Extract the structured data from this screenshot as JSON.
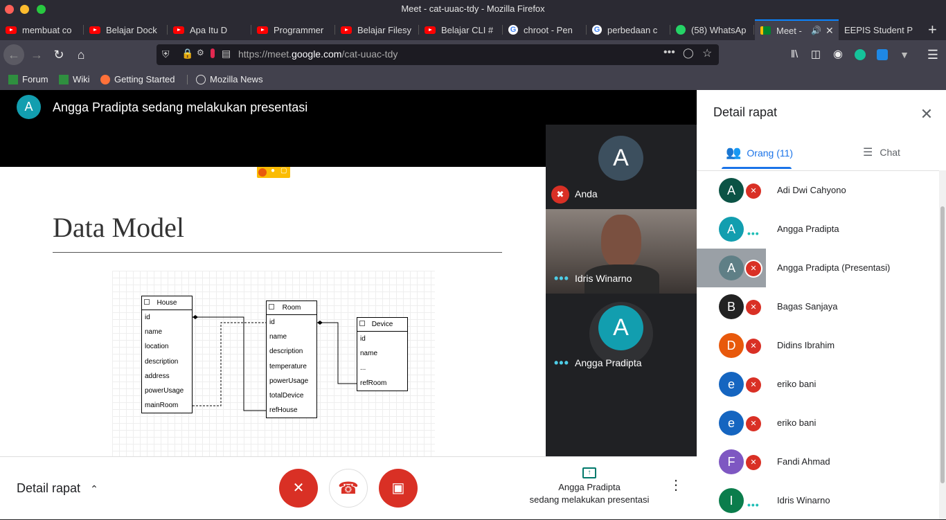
{
  "browser": {
    "window_title": "Meet - cat-uuac-tdy - Mozilla Firefox",
    "tabs": [
      {
        "label": "membuat co",
        "icon": "youtube-icon"
      },
      {
        "label": "Belajar Dock",
        "icon": "youtube-icon"
      },
      {
        "label": "Apa Itu D",
        "icon": "youtube-icon"
      },
      {
        "label": "Programmer",
        "icon": "youtube-icon"
      },
      {
        "label": "Belajar Filesy",
        "icon": "youtube-icon"
      },
      {
        "label": "Belajar CLI #",
        "icon": "youtube-icon"
      },
      {
        "label": "chroot - Pen",
        "icon": "google-icon"
      },
      {
        "label": "perbedaan c",
        "icon": "google-icon"
      },
      {
        "label": "(58) WhatsAp",
        "icon": "whatsapp-icon"
      },
      {
        "label": "Meet -",
        "icon": "meet-icon"
      },
      {
        "label": "EEPIS Student P",
        "icon": "eepis-icon"
      }
    ],
    "url_prefix": "https://meet.",
    "url_domain": "google.com",
    "url_path": "/cat-uuac-tdy",
    "bookmarks": [
      "Forum",
      "Wiki",
      "Getting Started",
      "Mozilla News"
    ]
  },
  "meet": {
    "presenter_initial": "A",
    "presenter_banner": "Angga Pradipta sedang melakukan presentasi",
    "slide": {
      "title": "Data Model",
      "entities": [
        {
          "name": "House",
          "fields": [
            "id",
            "name",
            "location",
            "description",
            "address",
            "powerUsage",
            "mainRoom"
          ]
        },
        {
          "name": "Room",
          "fields": [
            "id",
            "name",
            "description",
            "temperature",
            "powerUsage",
            "totalDevice",
            "refHouse"
          ]
        },
        {
          "name": "Device",
          "fields": [
            "id",
            "name",
            "...",
            "refRoom"
          ]
        }
      ]
    },
    "tiles": [
      {
        "initial": "A",
        "name": "Anda"
      },
      {
        "name": "Idris Winarno"
      },
      {
        "initial": "A",
        "name": "Angga Pradipta"
      }
    ],
    "panel": {
      "title": "Detail rapat",
      "tab_people": "Orang (11)",
      "tab_chat": "Chat",
      "participants": [
        {
          "initial": "A",
          "name": "Adi Dwi Cahyono",
          "color": "#0b5345",
          "status": "muted"
        },
        {
          "initial": "A",
          "name": "Angga Pradipta",
          "color": "#129eaf",
          "status": "speaking"
        },
        {
          "initial": "A",
          "name": "Angga Pradipta (Presentasi)",
          "color": "#5f7f86",
          "status": "muted"
        },
        {
          "initial": "B",
          "name": "Bagas Sanjaya",
          "color": "#222",
          "status": "muted"
        },
        {
          "initial": "D",
          "name": "Didins Ibrahim",
          "color": "#e8590c",
          "status": "muted"
        },
        {
          "initial": "e",
          "name": "eriko bani",
          "color": "#1565c0",
          "status": "muted"
        },
        {
          "initial": "e",
          "name": "eriko bani",
          "color": "#1565c0",
          "status": "muted"
        },
        {
          "initial": "F",
          "name": "Fandi Ahmad",
          "color": "#7e57c2",
          "status": "muted"
        },
        {
          "initial": "I",
          "name": "Idris Winarno",
          "color": "#0b7d4c",
          "status": "speaking"
        }
      ]
    },
    "bottom": {
      "details_label": "Detail rapat",
      "presenting_name": "Angga Pradipta",
      "presenting_text": "sedang melakukan presentasi"
    }
  }
}
